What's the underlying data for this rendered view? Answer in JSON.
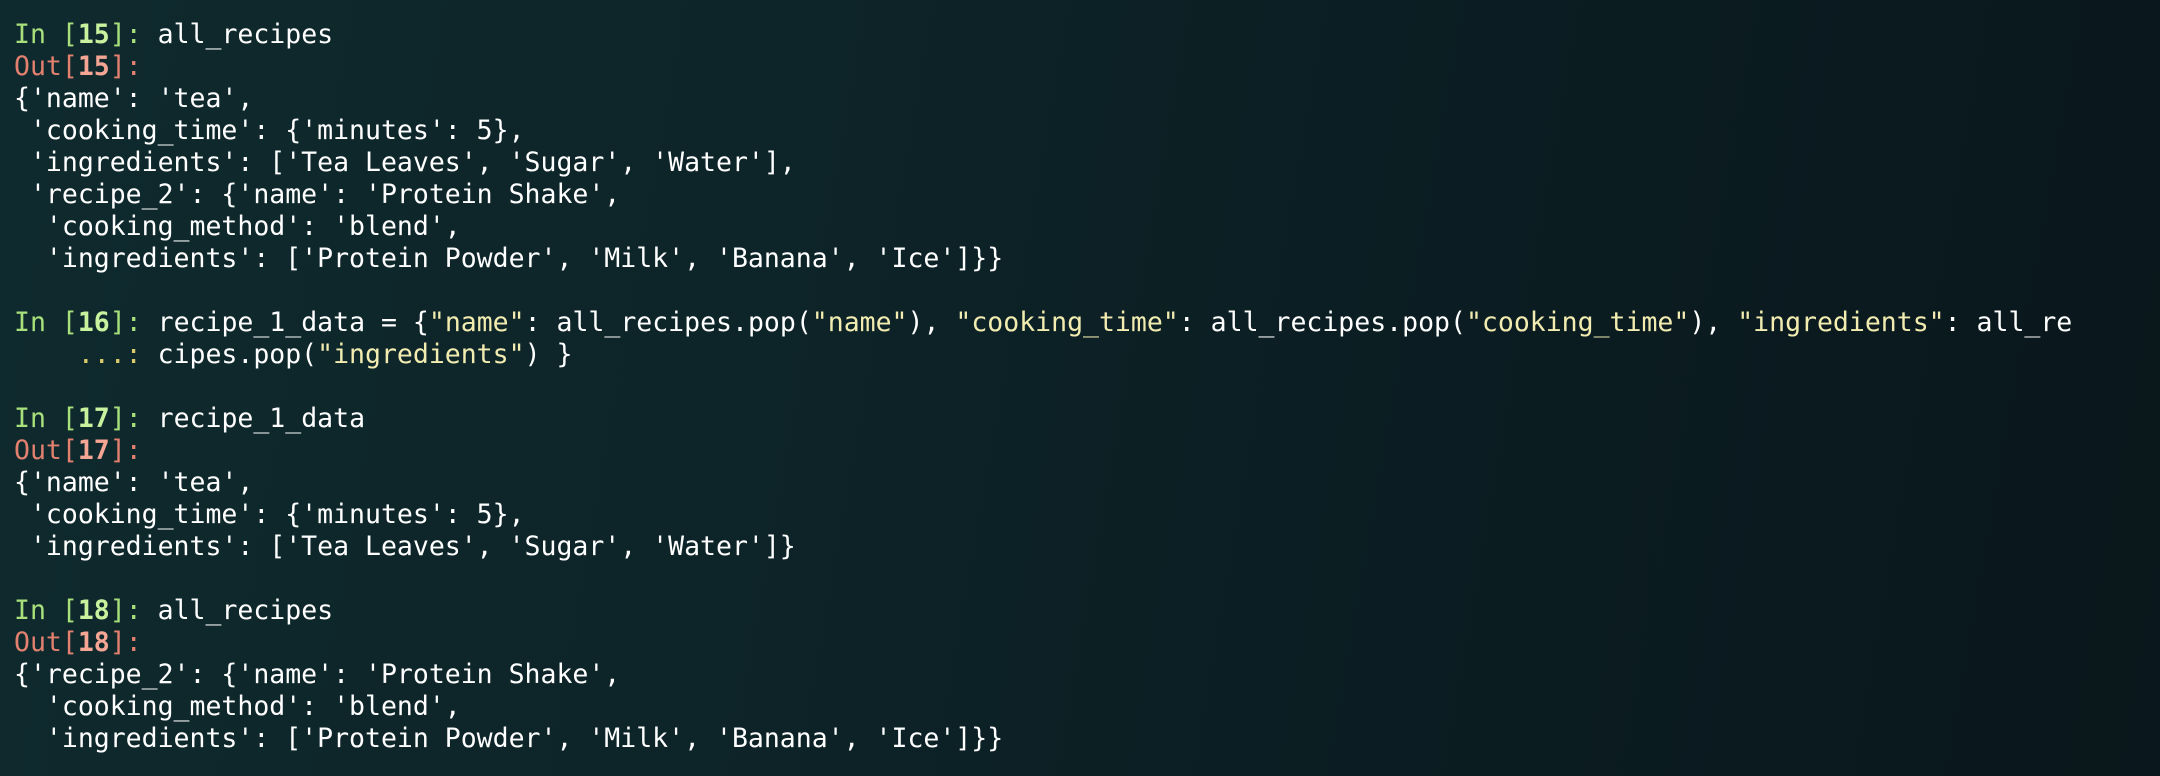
{
  "cells": [
    {
      "in_prefix": "In [",
      "in_number": "15",
      "in_suffix": "]: ",
      "code": "all_recipes",
      "out_prefix": "Out[",
      "out_number": "15",
      "out_suffix": "]:",
      "output_lines": [
        "{'name': 'tea',",
        " 'cooking_time': {'minutes': 5},",
        " 'ingredients': ['Tea Leaves', 'Sugar', 'Water'],",
        " 'recipe_2': {'name': 'Protein Shake',",
        "  'cooking_method': 'blend',",
        "  'ingredients': ['Protein Powder', 'Milk', 'Banana', 'Ice']}}"
      ]
    },
    {
      "in_prefix": "In [",
      "in_number": "16",
      "in_suffix": "]: ",
      "code_parts": [
        "recipe_1_data = {",
        "\"name\"",
        ": all_recipes.pop(",
        "\"name\"",
        "), ",
        "\"cooking_time\"",
        ": all_recipes.pop(",
        "\"cooking_time\"",
        "), ",
        "\"ingredients\"",
        ": all_re"
      ],
      "continuation_prompt": "    ...: ",
      "continuation_parts": [
        "cipes.pop(",
        "\"ingredients\"",
        ") }"
      ]
    },
    {
      "in_prefix": "In [",
      "in_number": "17",
      "in_suffix": "]: ",
      "code": "recipe_1_data",
      "out_prefix": "Out[",
      "out_number": "17",
      "out_suffix": "]:",
      "output_lines": [
        "{'name': 'tea',",
        " 'cooking_time': {'minutes': 5},",
        " 'ingredients': ['Tea Leaves', 'Sugar', 'Water']}"
      ]
    },
    {
      "in_prefix": "In [",
      "in_number": "18",
      "in_suffix": "]: ",
      "code": "all_recipes",
      "out_prefix": "Out[",
      "out_number": "18",
      "out_suffix": "]:",
      "output_lines": [
        "{'recipe_2': {'name': 'Protein Shake',",
        "  'cooking_method': 'blend',",
        "  'ingredients': ['Protein Powder', 'Milk', 'Banana', 'Ice']}}"
      ]
    }
  ],
  "colors": {
    "background": "#0d2428",
    "in_prompt": "#a8e07c",
    "out_prompt": "#e3806f",
    "string_literal": "#f2ecb0",
    "text": "#ffffff"
  }
}
